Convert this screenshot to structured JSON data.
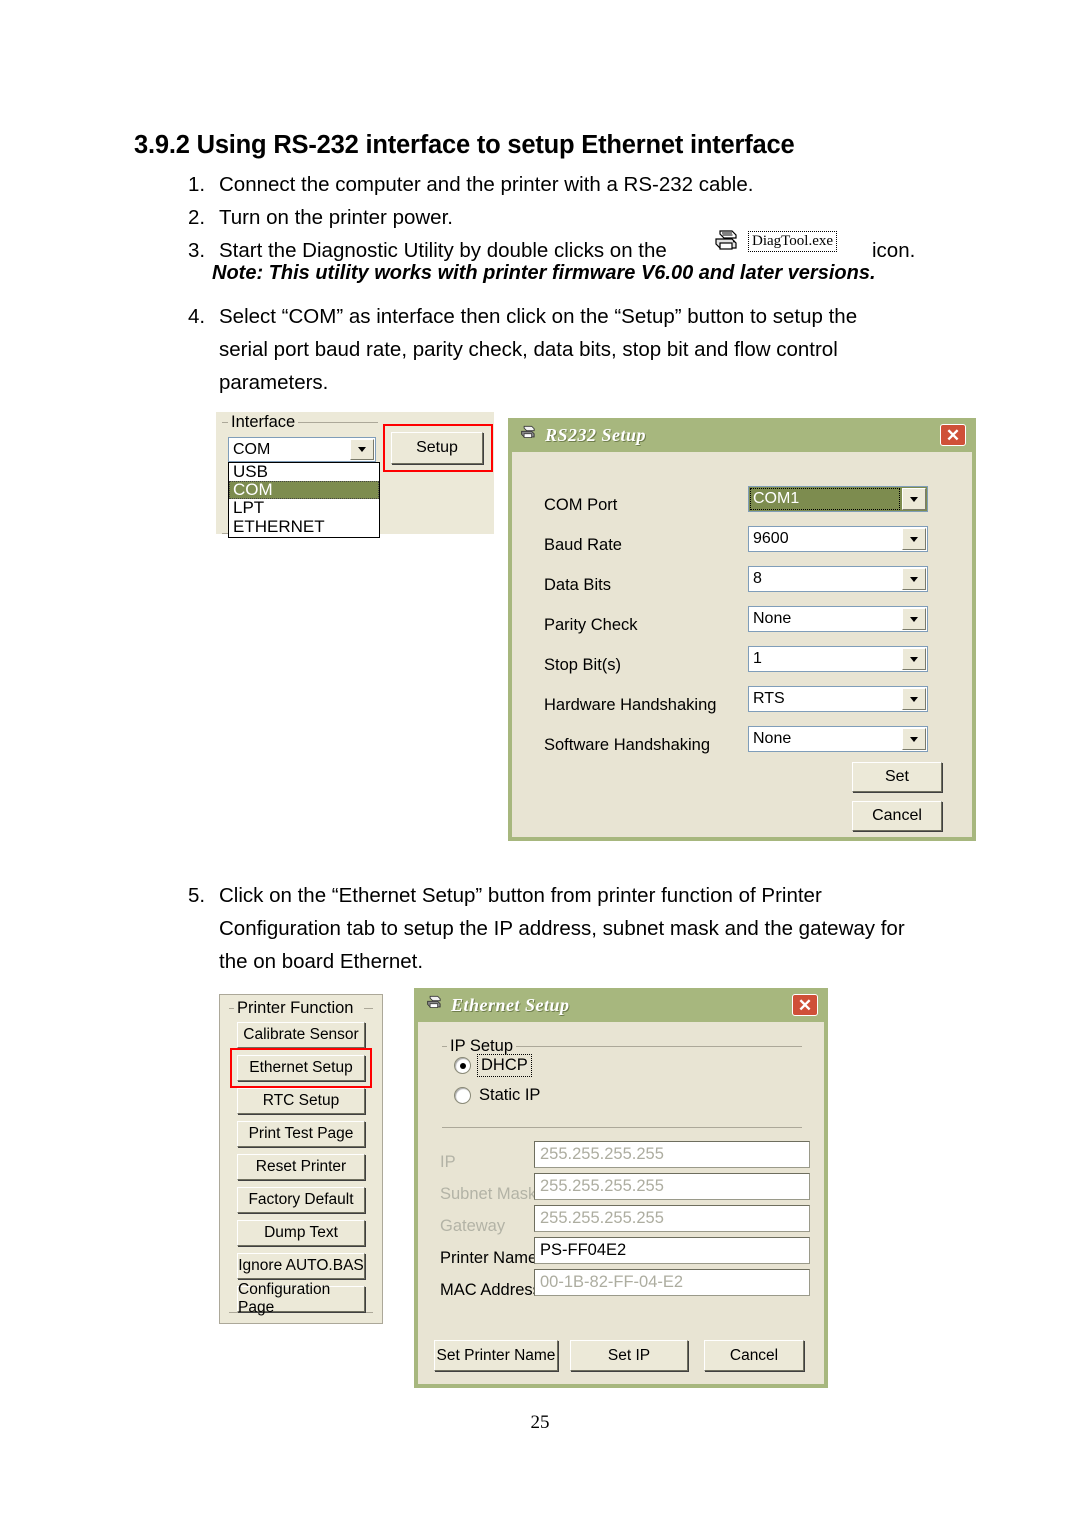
{
  "document": {
    "heading": "3.9.2 Using RS-232 interface to setup Ethernet interface",
    "page_number": "25",
    "steps": [
      {
        "num": "1.",
        "lines": [
          "Connect the computer and the printer with a RS-232 cable."
        ]
      },
      {
        "num": "2.",
        "lines": [
          "Turn on the printer power."
        ]
      },
      {
        "num": "3.",
        "lines": [
          "Start the Diagnostic Utility by double clicks on the",
          "icon."
        ]
      },
      {
        "num": "4.",
        "lines": [
          "Select “COM” as interface then click on the “Setup” button to setup the",
          "serial port baud rate, parity check, data bits, stop bit and flow control",
          "parameters."
        ]
      },
      {
        "num": "5.",
        "lines": [
          "Click on the “Ethernet Setup” button from printer function of Printer",
          "Configuration tab to setup the IP address, subnet mask and the gateway for",
          "the on board Ethernet."
        ]
      }
    ],
    "step3_prefix": "Start the Diagnostic Utility by double clicks on the",
    "step3_suffix": "icon.",
    "note": "Note: This utility works with printer firmware V6.00 and later versions.",
    "diagtool_icon_label": "DiagTool.exe"
  },
  "interface_panel": {
    "group_caption": "Interface",
    "selected_value": "COM",
    "options": [
      "USB",
      "COM",
      "LPT",
      "ETHERNET"
    ],
    "highlighted_option": "COM",
    "setup_button": "Setup"
  },
  "rs232_dialog": {
    "title": "RS232 Setup",
    "close_label": "✕",
    "fields": [
      {
        "label": "COM Port",
        "value": "COM1",
        "selected": true
      },
      {
        "label": "Baud Rate",
        "value": "9600",
        "selected": false
      },
      {
        "label": "Data Bits",
        "value": "8",
        "selected": false
      },
      {
        "label": "Parity Check",
        "value": "None",
        "selected": false
      },
      {
        "label": "Stop Bit(s)",
        "value": "1",
        "selected": false
      },
      {
        "label": "Hardware Handshaking",
        "value": "RTS",
        "selected": false
      },
      {
        "label": "Software Handshaking",
        "value": "None",
        "selected": false
      }
    ],
    "set_button": "Set",
    "cancel_button": "Cancel"
  },
  "printer_function_panel": {
    "group_caption": "Printer Function",
    "buttons": [
      "Calibrate Sensor",
      "Ethernet Setup",
      "RTC Setup",
      "Print Test Page",
      "Reset Printer",
      "Factory Default",
      "Dump Text",
      "Ignore AUTO.BAS",
      "Configuration Page"
    ],
    "highlighted_button": "Ethernet Setup"
  },
  "ethernet_dialog": {
    "title": "Ethernet Setup",
    "close_label": "✕",
    "ip_setup_caption": "IP Setup",
    "radios": [
      {
        "label": "DHCP",
        "checked": true,
        "focused": true
      },
      {
        "label": "Static IP",
        "checked": false,
        "focused": false
      }
    ],
    "fields": [
      {
        "label": "IP",
        "value": "255.255.255.255",
        "disabled": true
      },
      {
        "label": "Subnet Mask",
        "value": "255.255.255.255",
        "disabled": true
      },
      {
        "label": "Gateway",
        "value": "255.255.255.255",
        "disabled": true
      },
      {
        "label": "Printer Name",
        "value": "PS-FF04E2",
        "disabled": false
      },
      {
        "label": "MAC Address",
        "value": "00-1B-82-FF-04-E2",
        "disabled": true
      }
    ],
    "buttons": [
      "Set Printer Name",
      "Set IP",
      "Cancel"
    ]
  },
  "colors": {
    "dialog_title_olive": "#a7b77e",
    "dialog_body_beige": "#e8e4d3",
    "selection_olive": "#7d8c4f",
    "highlight_red": "#ff0000",
    "close_red": "#cf5038",
    "win_face": "#ece9d8"
  }
}
